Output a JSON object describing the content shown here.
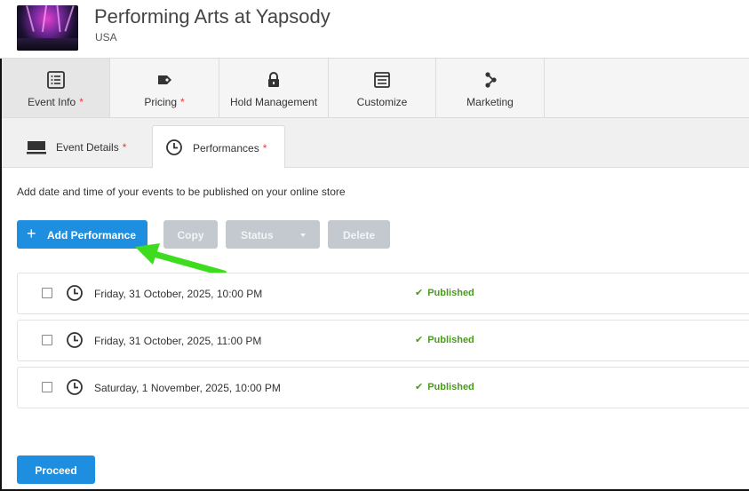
{
  "event": {
    "title": "Performing Arts at Yapsody",
    "location": "USA"
  },
  "main_tabs": [
    {
      "label": "Event Info",
      "required": "*",
      "icon": "list-icon"
    },
    {
      "label": "Pricing",
      "required": "*",
      "icon": "tag-icon"
    },
    {
      "label": "Hold Management",
      "required": "",
      "icon": "lock-icon"
    },
    {
      "label": "Customize",
      "required": "",
      "icon": "layout-icon"
    },
    {
      "label": "Marketing",
      "required": "",
      "icon": "share-icon"
    }
  ],
  "sub_tabs": [
    {
      "label": "Event Details",
      "required": "*",
      "icon": "monitor-icon"
    },
    {
      "label": "Performances",
      "required": "*",
      "icon": "clock-icon"
    }
  ],
  "description": "Add date and time of your events to be published on your online store",
  "toolbar": {
    "add_label": "Add Performance",
    "copy_label": "Copy",
    "status_label": "Status",
    "delete_label": "Delete"
  },
  "performances": [
    {
      "datetime": "Friday, 31 October, 2025, 10:00 PM",
      "status": "Published"
    },
    {
      "datetime": "Friday, 31 October, 2025, 11:00 PM",
      "status": "Published"
    },
    {
      "datetime": "Saturday, 1 November, 2025, 10:00 PM",
      "status": "Published"
    }
  ],
  "proceed_label": "Proceed",
  "colors": {
    "primary": "#1e8fe0",
    "published": "#4a9a1e",
    "required": "#e53935",
    "annotation_arrow": "#3ddc1e"
  }
}
